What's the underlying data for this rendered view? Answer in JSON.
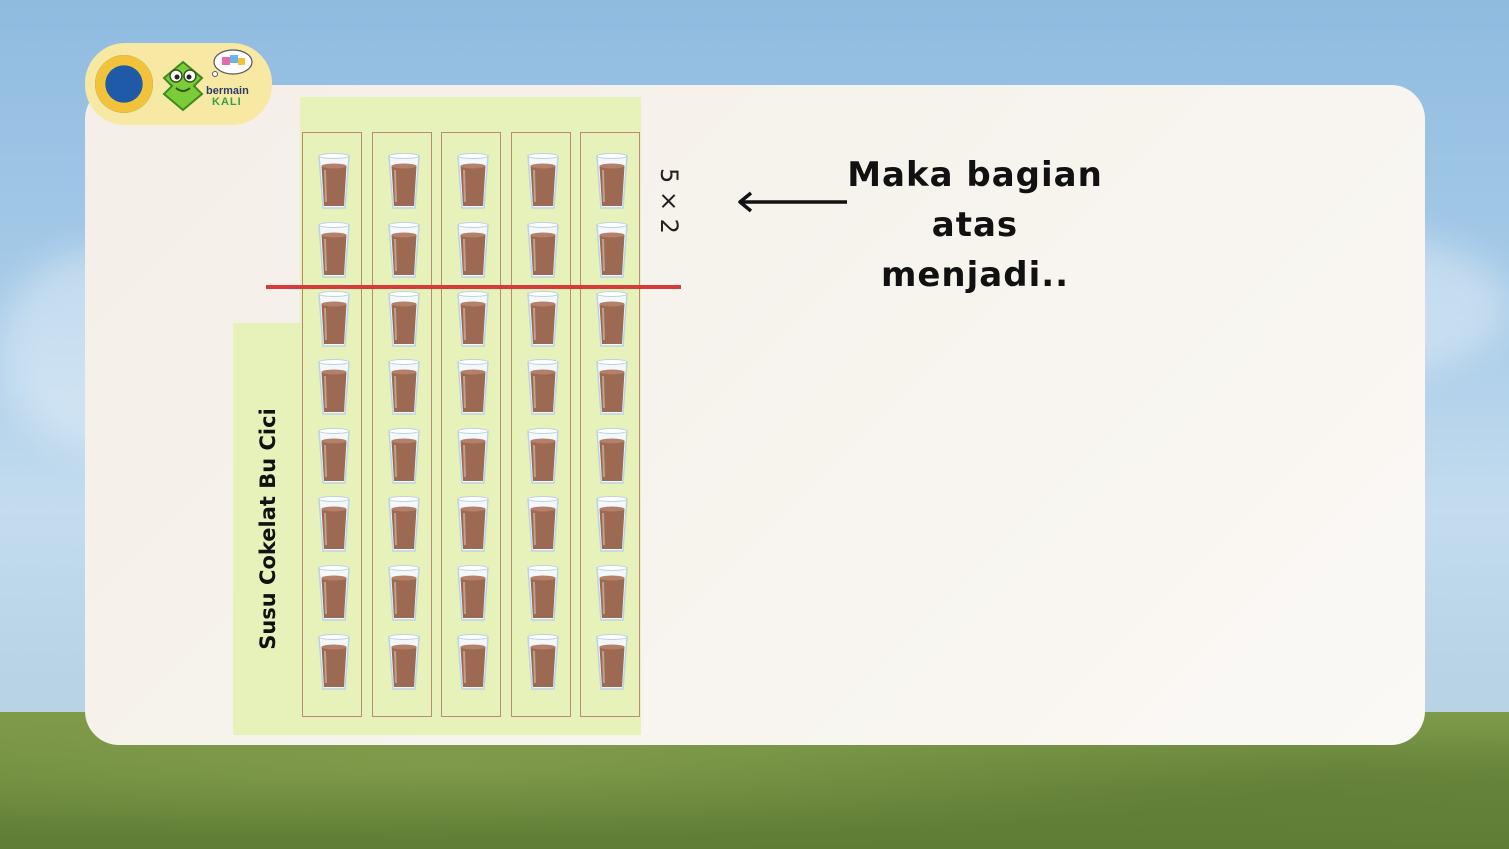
{
  "background": {
    "sky_color": "#a7cbe8",
    "grass_color": "#6d8a3d",
    "card_color": "#f6f2ec"
  },
  "logo": {
    "emblem_icon": "ministry-emblem-icon",
    "mascot_icon": "green-mascot-icon",
    "bubble_icon": "thought-bubble-blocks-icon",
    "brand_line1": "bermain",
    "brand_line2": "KALI"
  },
  "diagram": {
    "label": "Susu Cokelat Bu Cici",
    "columns": 5,
    "glasses_per_column": 8,
    "glass_icon": "chocolate-milk-glass-icon",
    "divider_after_row": 2,
    "divider_color": "#d63a3a",
    "panel_color": "#e6f2ba",
    "expression": "5 × 2"
  },
  "caption": {
    "line1": "Maka bagian",
    "line2": "atas menjadi.."
  }
}
